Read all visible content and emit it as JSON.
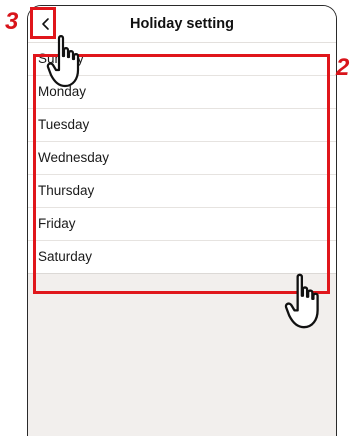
{
  "header": {
    "title": "Holiday setting",
    "back_icon": "chevron-left-icon"
  },
  "days": [
    {
      "label": "Sunday"
    },
    {
      "label": "Monday"
    },
    {
      "label": "Tuesday"
    },
    {
      "label": "Wednesday"
    },
    {
      "label": "Thursday"
    },
    {
      "label": "Friday"
    },
    {
      "label": "Saturday"
    }
  ],
  "callouts": {
    "back": "3",
    "list": "2"
  },
  "colors": {
    "highlight": "#e0161b",
    "callout": "#d8141a",
    "background": "#f2efed"
  },
  "icons": {
    "pointer": "pointing-hand-icon"
  }
}
